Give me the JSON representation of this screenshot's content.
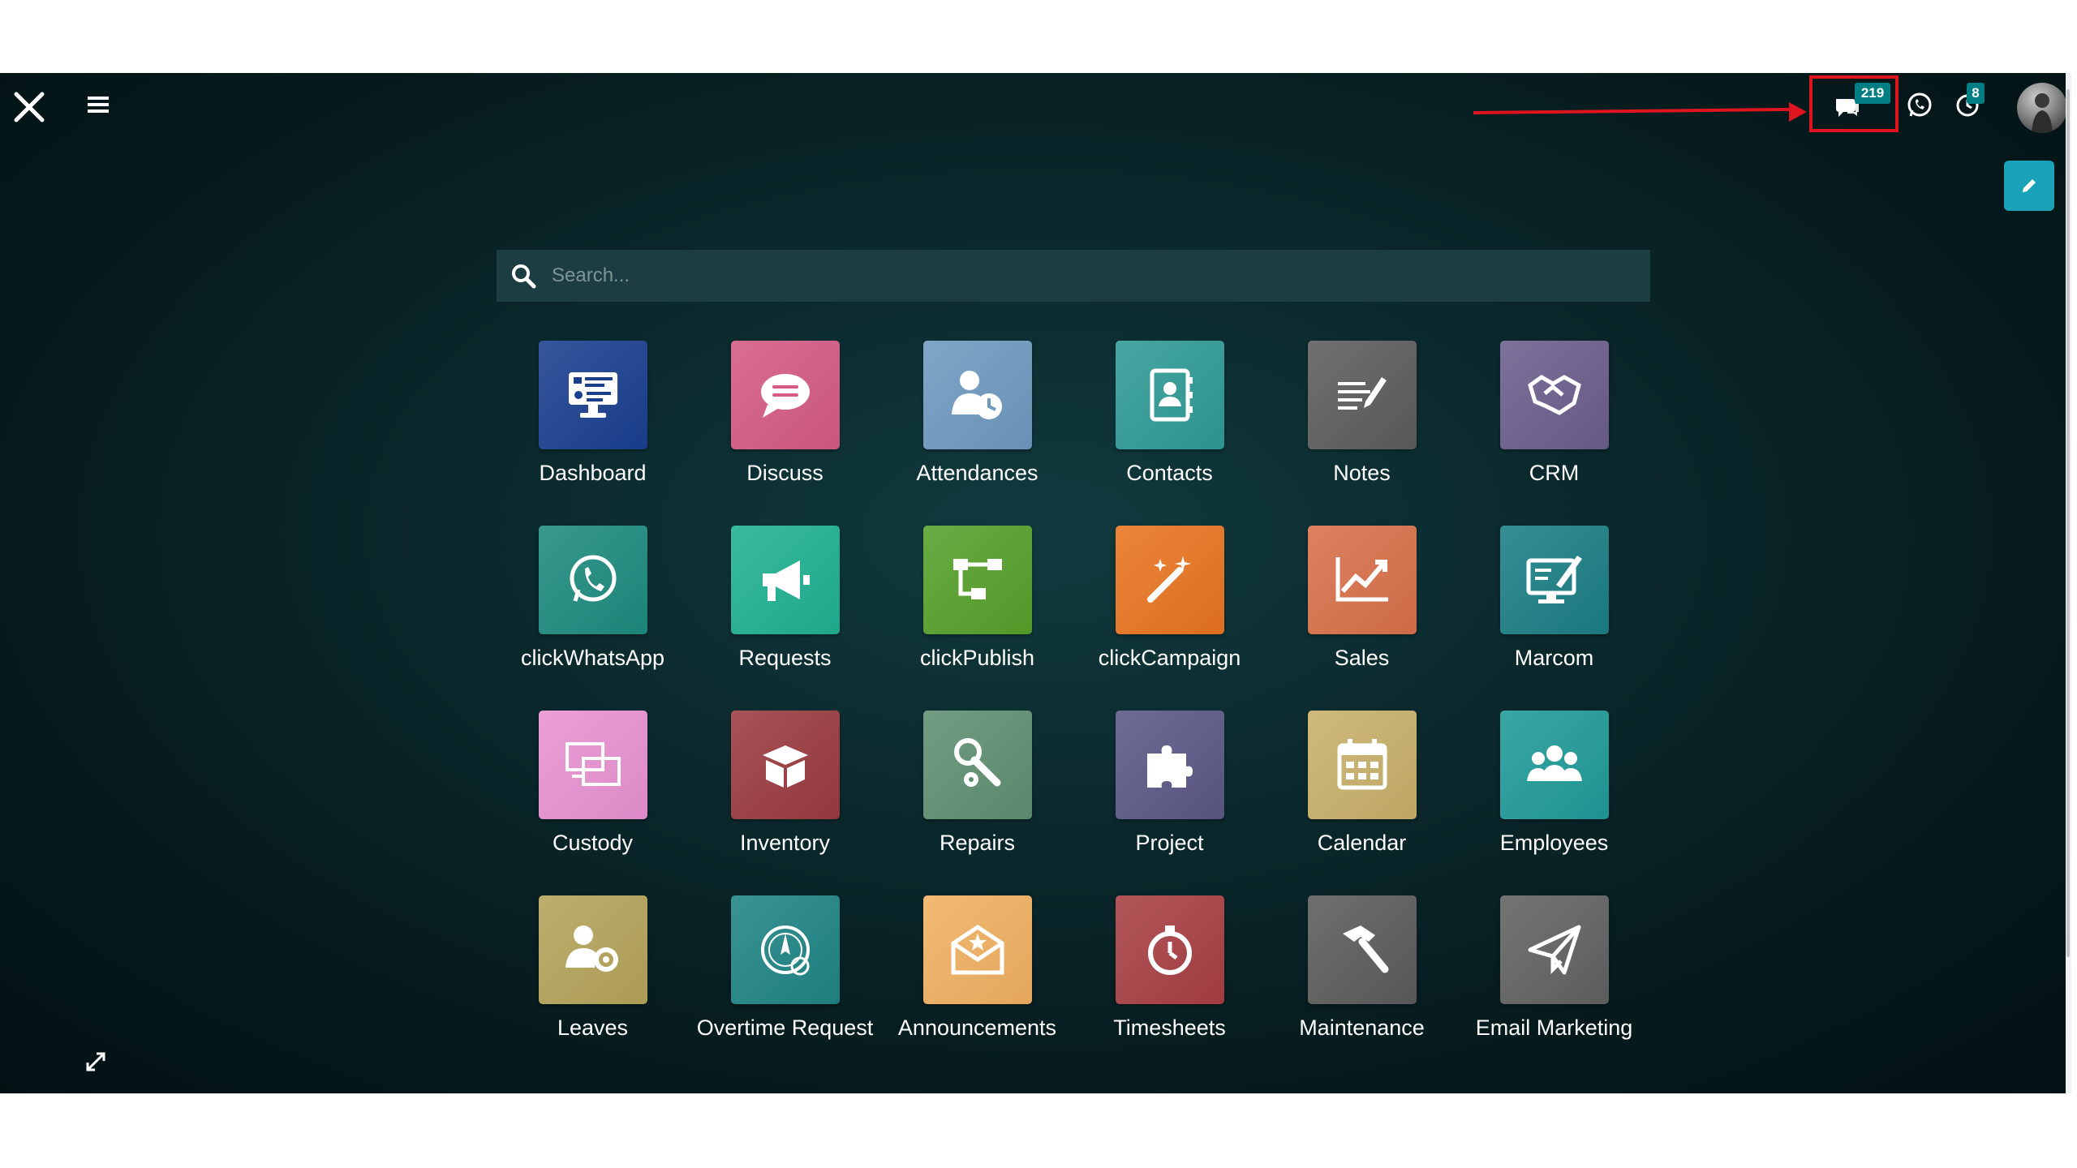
{
  "topbar": {
    "messages_badge": "219",
    "activities_badge": "8"
  },
  "search": {
    "placeholder": "Search..."
  },
  "apps": [
    {
      "label": "Dashboard",
      "icon": "monitor-dashboard-icon",
      "color": "#1a3f8f"
    },
    {
      "label": "Discuss",
      "icon": "chat-bubble-icon",
      "color": "#d45a82"
    },
    {
      "label": "Attendances",
      "icon": "user-clock-icon",
      "color": "#6e99bf"
    },
    {
      "label": "Contacts",
      "icon": "address-book-icon",
      "color": "#2e9a95"
    },
    {
      "label": "Notes",
      "icon": "note-pencil-icon",
      "color": "#5c5c5c"
    },
    {
      "label": "CRM",
      "icon": "handshake-icon",
      "color": "#6b5e8c"
    },
    {
      "label": "clickWhatsApp",
      "icon": "whatsapp-icon",
      "color": "#1d8a7e"
    },
    {
      "label": "Requests",
      "icon": "megaphone-icon",
      "color": "#1fb091"
    },
    {
      "label": "clickPublish",
      "icon": "sitemap-icon",
      "color": "#55a02a"
    },
    {
      "label": "clickCampaign",
      "icon": "magic-wand-icon",
      "color": "#e8741f"
    },
    {
      "label": "Sales",
      "icon": "chart-line-icon",
      "color": "#d8704a"
    },
    {
      "label": "Marcom",
      "icon": "monitor-brush-icon",
      "color": "#1a7e84"
    },
    {
      "label": "Custody",
      "icon": "devices-icon",
      "color": "#e891d1"
    },
    {
      "label": "Inventory",
      "icon": "box-open-icon",
      "color": "#9a3b3f"
    },
    {
      "label": "Repairs",
      "icon": "wrench-gear-icon",
      "color": "#5e8f72"
    },
    {
      "label": "Project",
      "icon": "puzzle-icon",
      "color": "#5a5785"
    },
    {
      "label": "Calendar",
      "icon": "calendar-icon",
      "color": "#c8b06a"
    },
    {
      "label": "Employees",
      "icon": "users-icon",
      "color": "#1f9a98"
    },
    {
      "label": "Leaves",
      "icon": "user-gear-icon",
      "color": "#b4a35a"
    },
    {
      "label": "Overtime Request",
      "icon": "clock-compass-icon",
      "color": "#1f8484"
    },
    {
      "label": "Announcements",
      "icon": "envelope-star-icon",
      "color": "#f0b061"
    },
    {
      "label": "Timesheets",
      "icon": "stopwatch-icon",
      "color": "#a73f43"
    },
    {
      "label": "Maintenance",
      "icon": "hammer-icon",
      "color": "#5b5b5b"
    },
    {
      "label": "Email Marketing",
      "icon": "paper-plane-icon",
      "color": "#616161"
    }
  ]
}
